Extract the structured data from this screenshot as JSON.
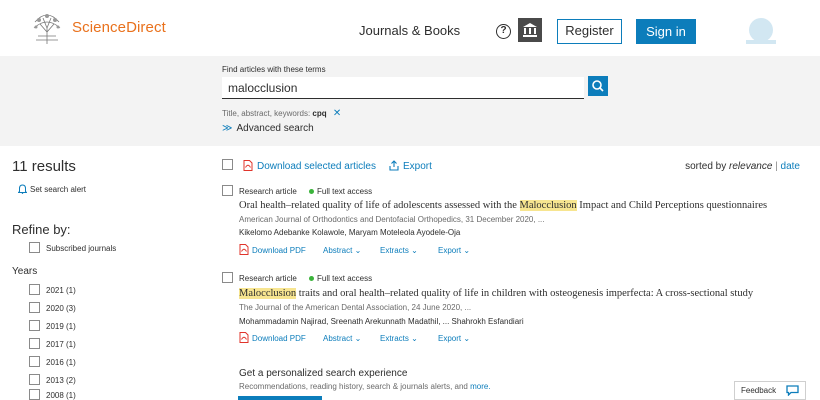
{
  "header": {
    "logo_text": "ScienceDirect",
    "nav_journals_books": "Journals & Books",
    "help_symbol": "?",
    "register_label": "Register",
    "signin_label": "Sign in"
  },
  "search": {
    "find_label": "Find articles with these terms",
    "query_value": "malocclusion",
    "filter_prefix": "Title, abstract, keywords:",
    "filter_term": "cpq",
    "filter_remove": "✕",
    "advanced_label": "Advanced search",
    "advanced_chevron": "≫"
  },
  "sidebar": {
    "results_count": "11 results",
    "set_alert": "Set search alert",
    "refine_heading": "Refine by:",
    "subscribed_label": "Subscribed journals",
    "years_heading": "Years",
    "years": [
      "2021 (1)",
      "2020 (3)",
      "2019 (1)",
      "2017 (1)",
      "2016 (1)",
      "2013 (2)",
      "2008 (1)"
    ]
  },
  "toolbar": {
    "download_selected": "Download selected articles",
    "export": "Export",
    "sorted_by": "sorted by ",
    "relevance": "relevance",
    "separator": " | ",
    "date": "date"
  },
  "articles": [
    {
      "type": "Research article",
      "access": "Full text access",
      "title_pre": "Oral health–related quality of life of adolescents assessed with the ",
      "title_hl": "Malocclusion",
      "title_post": " Impact and Child Perceptions questionnaires",
      "journal": "American Journal of Orthodontics and Dentofacial Orthopedics, 31 December 2020, ...",
      "authors": "Kikelomo Adebanke Kolawole, Maryam Moteleola Ayodele-Oja",
      "download_pdf": "Download PDF",
      "abstract": "Abstract",
      "extracts": "Extracts",
      "export": "Export"
    },
    {
      "type": "Research article",
      "access": "Full text access",
      "title_pre": "",
      "title_hl": "Malocclusion",
      "title_post": " traits and oral health–related quality of life in children with osteogenesis imperfecta: A cross-sectional study",
      "journal": "The Journal of the American Dental Association, 24 June 2020, ...",
      "authors": "Mohammadamin Najirad, Sreenath Arekunnath Madathil, ... Shahrokh Esfandiari",
      "download_pdf": "Download PDF",
      "abstract": "Abstract",
      "extracts": "Extracts",
      "export": "Export"
    }
  ],
  "personalize": {
    "title": "Get a personalized search experience",
    "subtitle": "Recommendations, reading history, search & journals alerts, and ",
    "more": "more."
  },
  "feedback": {
    "label": "Feedback"
  },
  "colors": {
    "accent": "#0c7dbb",
    "brand": "#e9711c",
    "highlight": "#f7e590",
    "access_dot": "#3ab33a"
  }
}
